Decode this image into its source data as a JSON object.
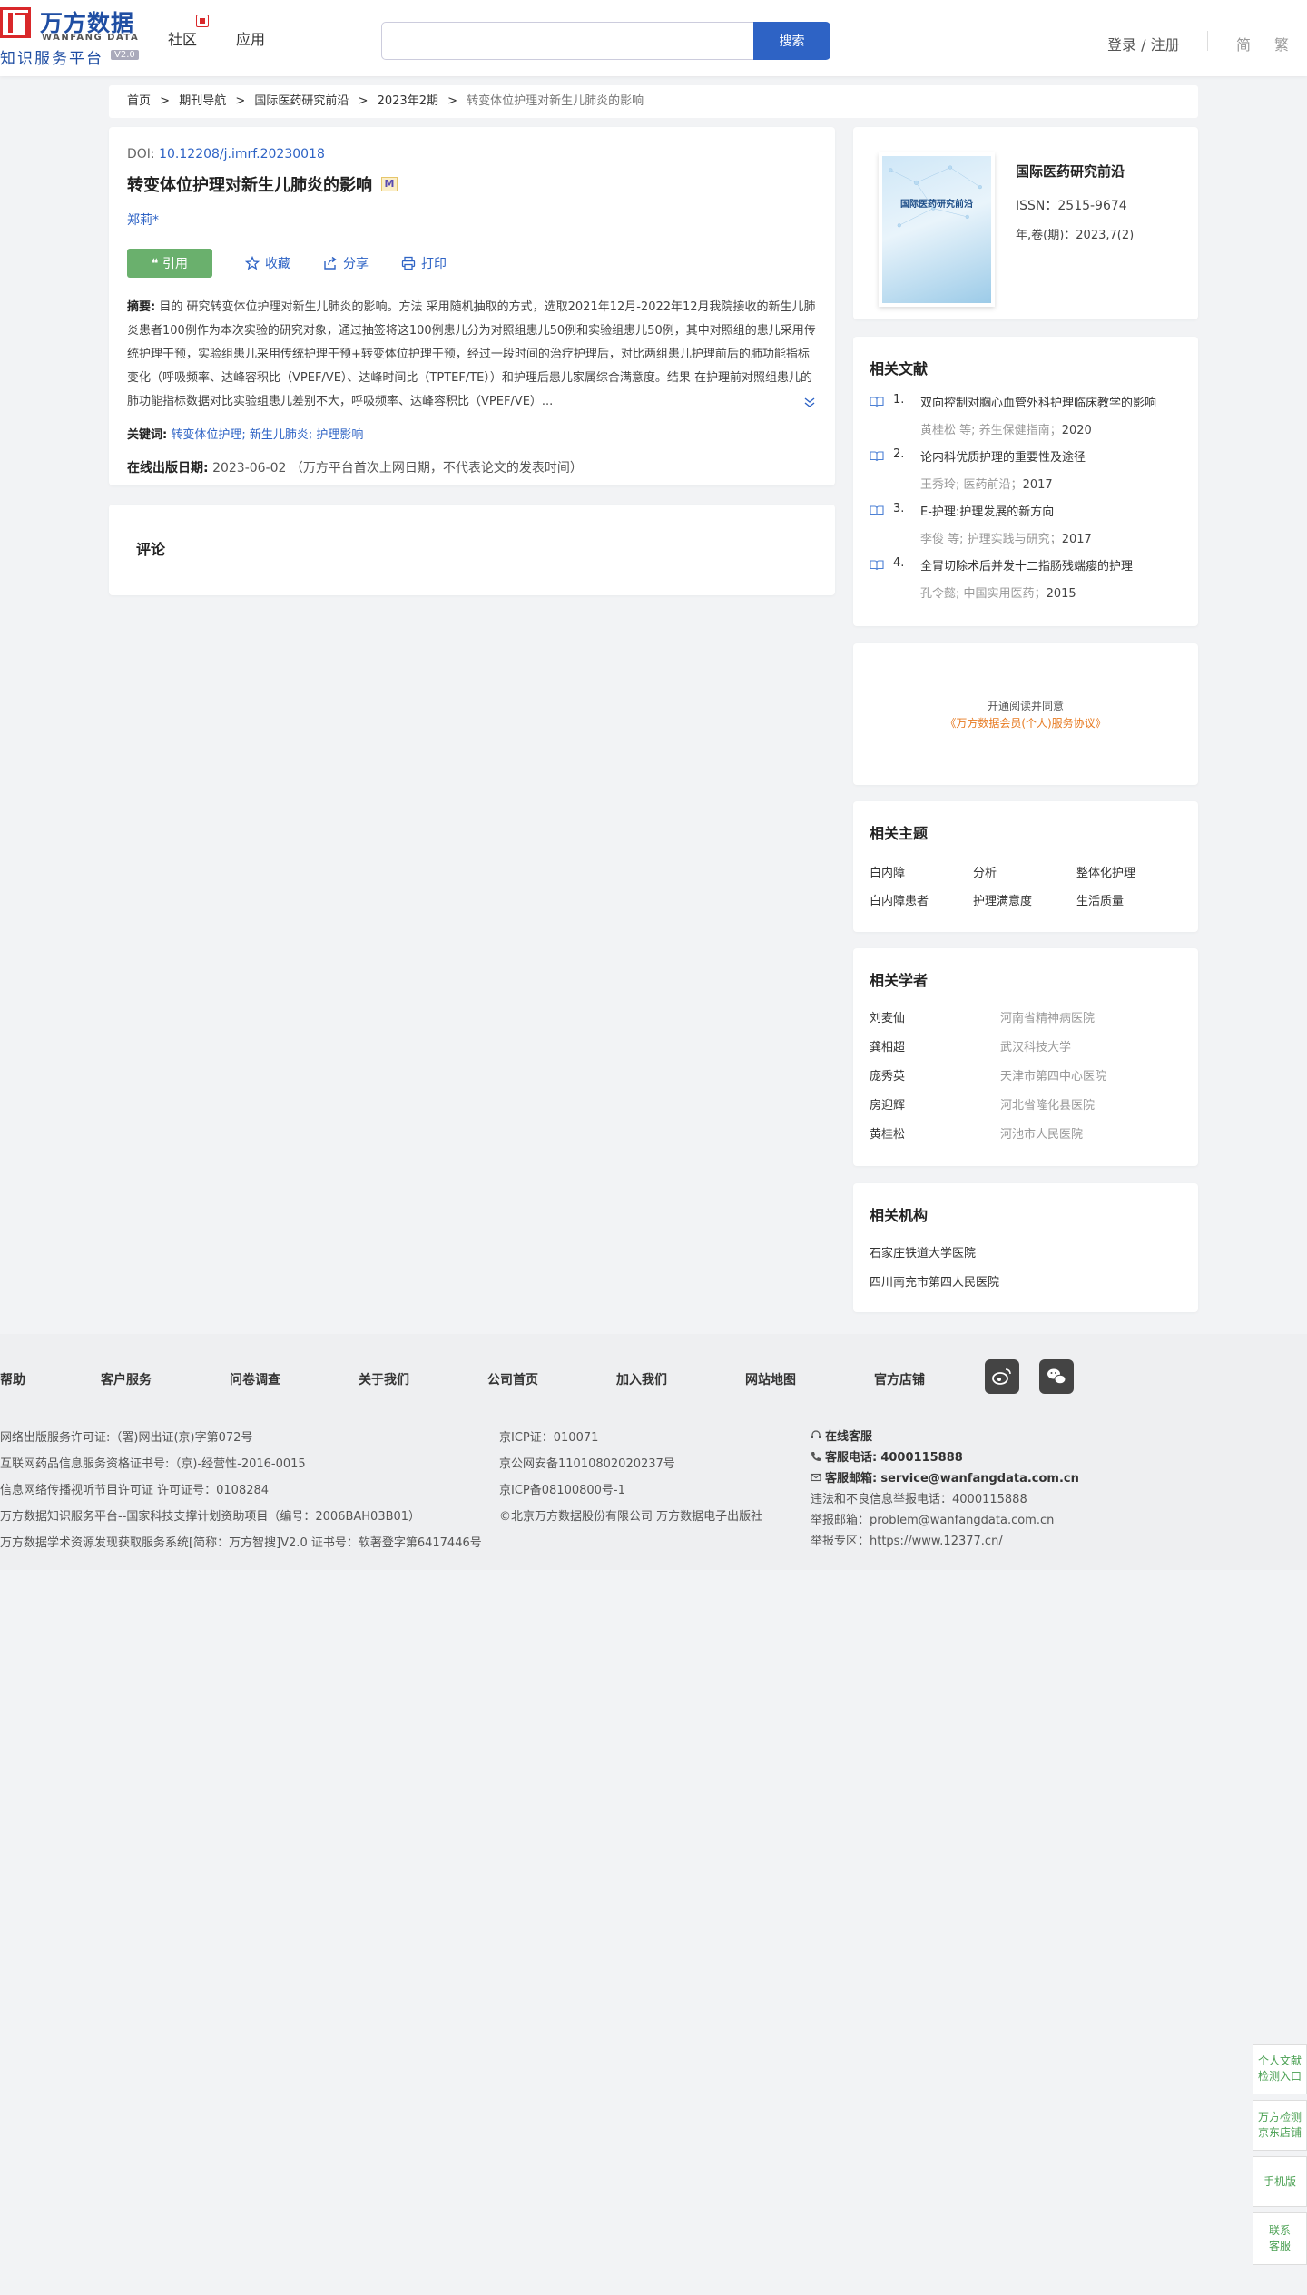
{
  "header": {
    "logo_cn": "万方数据",
    "logo_en": "WANFANG DATA",
    "logo_sub": "知识服务平台",
    "logo_version": "V2.0",
    "nav": [
      "社区",
      "应用"
    ],
    "search_placeholder": "",
    "search_button": "搜索",
    "login": "登录 / 注册",
    "lang_simplified": "简",
    "lang_traditional": "繁"
  },
  "breadcrumb": [
    "首页",
    ">",
    "期刊导航",
    ">",
    "国际医药研究前沿",
    ">",
    "2023年2期",
    ">",
    "转变体位护理对新生儿肺炎的影响"
  ],
  "article": {
    "doi_label": "DOI:",
    "doi": "10.12208/j.imrf.20230018",
    "title": "转变体位护理对新生儿肺炎的影响",
    "title_badge": "M",
    "author": "郑莉*",
    "actions": {
      "cite": "引用",
      "collect": "收藏",
      "share": "分享",
      "print": "打印"
    },
    "abstract_label": "摘要:",
    "abstract": "目的 研究转变体位护理对新生儿肺炎的影响。方法 采用随机抽取的方式，选取2021年12月-2022年12月我院接收的新生儿肺炎患者100例作为本次实验的研究对象，通过抽签将这100例患儿分为对照组患儿50例和实验组患儿50例，其中对照组的患儿采用传统护理干预，实验组患儿采用传统护理干预+转变体位护理干预，经过一段时间的治疗护理后，对比两组患儿护理前后的肺功能指标变化（呼吸频率、达峰容积比（VPEF/VE）、达峰时间比（TPTEF/TE））和护理后患儿家属综合满意度。结果 在护理前对照组患儿的肺功能指标数据对比实验组患儿差别不大，呼吸频率、达峰容积比（VPEF/VE）...",
    "keywords_label": "关键词:",
    "keywords": "转变体位护理; 新生儿肺炎; 护理影响",
    "online_label": "在线出版日期:",
    "online_date": "2023-06-02",
    "online_note": "（万方平台首次上网日期，不代表论文的发表时间）"
  },
  "comments": {
    "title": "评论"
  },
  "journal": {
    "cover_title": "国际医药研究前沿",
    "name": "国际医药研究前沿",
    "issn": "ISSN：2515-9674",
    "volume": "年,卷(期)：2023,7(2)"
  },
  "related_docs": {
    "title": "相关文献",
    "items": [
      {
        "num": "1.",
        "title": "双向控制对胸心血管外科护理临床教学的影响",
        "authors": "黄桂松  等;",
        "source": "养生保健指南",
        "year": "2020"
      },
      {
        "num": "2.",
        "title": "论内科优质护理的重要性及途径",
        "authors": "王秀玲;",
        "source": "医药前沿",
        "year": "2017"
      },
      {
        "num": "3.",
        "title": "E-护理:护理发展的新方向",
        "authors": "李俊  等;",
        "source": "护理实践与研究",
        "year": "2017"
      },
      {
        "num": "4.",
        "title": "全胃切除术后并发十二指肠残端瘘的护理",
        "authors": "孔令懿;",
        "source": "中国实用医药",
        "year": "2015"
      }
    ]
  },
  "agreement": {
    "line1": "开通阅读并同意",
    "line2": "《万方数据会员(个人)服务协议》"
  },
  "topics": {
    "title": "相关主题",
    "items": [
      "白内障",
      "分析",
      "整体化护理",
      "白内障患者",
      "护理满意度",
      "生活质量"
    ]
  },
  "scholars": {
    "title": "相关学者",
    "items": [
      {
        "name": "刘麦仙",
        "org": "河南省精神病医院"
      },
      {
        "name": "龚相超",
        "org": "武汉科技大学"
      },
      {
        "name": "庞秀英",
        "org": "天津市第四中心医院"
      },
      {
        "name": "房迎辉",
        "org": "河北省隆化县医院"
      },
      {
        "name": "黄桂松",
        "org": "河池市人民医院"
      }
    ]
  },
  "orgs": {
    "title": "相关机构",
    "items": [
      "石家庄铁道大学医院",
      "四川南充市第四人民医院"
    ]
  },
  "footer": {
    "links": [
      "帮助",
      "客户服务",
      "问卷调查",
      "关于我们",
      "公司首页",
      "加入我们",
      "网站地图",
      "官方店铺"
    ],
    "col1": [
      "网络出版服务许可证:（署)网出证(京)字第072号",
      "互联网药品信息服务资格证书号:（京)-经营性-2016-0015",
      "信息网络传播视听节目许可证 许可证号：0108284",
      "万方数据知识服务平台--国家科技支撑计划资助项目（编号：2006BAH03B01）",
      "万方数据学术资源发现获取服务系统[简称：万方智搜]V2.0 证书号：软著登字第6417446号"
    ],
    "col2": [
      "京ICP证：010071",
      "京公网安备11010802020237号",
      "京ICP备08100800号-1",
      "©北京万方数据股份有限公司 万方数据电子出版社"
    ],
    "col3": {
      "online_service": "在线客服",
      "phone_label": "客服电话:",
      "phone": "4000115888",
      "email_label": "客服邮箱:",
      "email": "service@wanfangdata.com.cn",
      "report_phone": "违法和不良信息举报电话：4000115888",
      "report_email": "举报邮箱：problem@wanfangdata.com.cn",
      "report_area": "举报专区：https://www.12377.cn/"
    }
  },
  "floating": {
    "detect": "个人文献检测入口",
    "store": "万方检测京东店铺",
    "mobile": "手机版",
    "contact": "联系客服"
  },
  "colors": {
    "brand_blue": "#2e63c5",
    "cite_green": "#6ab06d",
    "logo_red": "#d9282a",
    "agree_orange": "#e77a21"
  }
}
